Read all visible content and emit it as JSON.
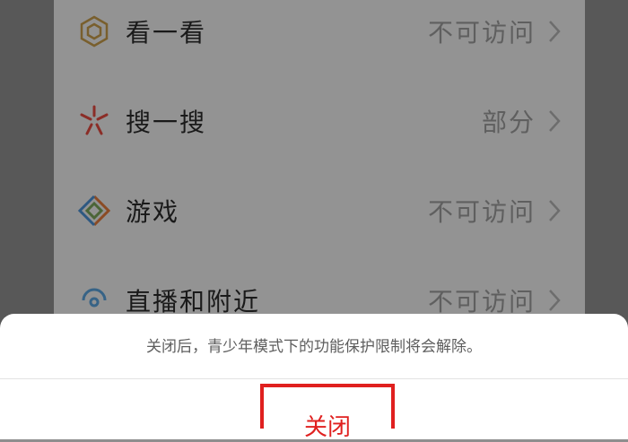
{
  "settings": {
    "items": [
      {
        "label": "看一看",
        "value": "不可访问",
        "icon": "look-icon",
        "icon_color": "#c49a4a"
      },
      {
        "label": "搜一搜",
        "value": "部分",
        "icon": "search-icon",
        "icon_color": "#e0493f"
      },
      {
        "label": "游戏",
        "value": "不可访问",
        "icon": "games-icon",
        "icon_color": "#7aa35a"
      },
      {
        "label": "直播和附近",
        "value": "不可访问",
        "icon": "nearby-icon",
        "icon_color": "#5aa0d8"
      }
    ]
  },
  "sheet": {
    "message": "关闭后，青少年模式下的功能保护限制将会解除。",
    "close_label": "关闭"
  },
  "colors": {
    "accent_red": "#e0201f",
    "overlay": "#8e8e8e"
  }
}
